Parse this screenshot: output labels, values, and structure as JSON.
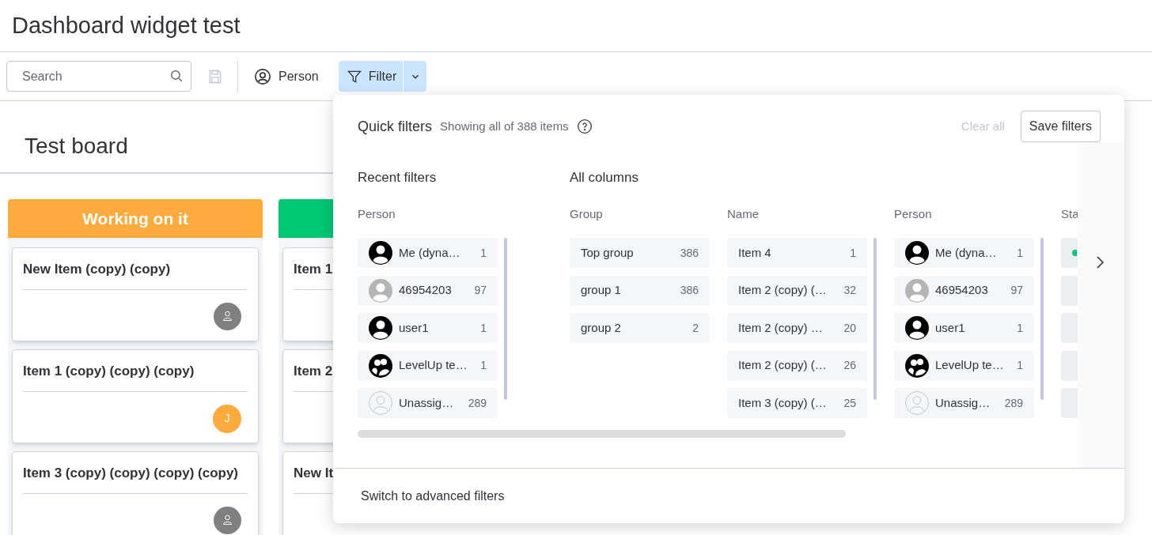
{
  "page": {
    "title": "Dashboard widget test"
  },
  "toolbar": {
    "search": {
      "placeholder": "Search"
    },
    "person_button": "Person",
    "filter_button": {
      "label": "Filter",
      "active": true
    }
  },
  "board": {
    "title": "Test board",
    "groups": [
      {
        "title": "Working on it",
        "color": "#fdab3d",
        "cards": [
          {
            "title": "New Item (copy) (copy)",
            "assignee": {
              "kind": "placeholder"
            }
          },
          {
            "title": "Item 1 (copy) (copy) (copy)",
            "assignee": {
              "kind": "initial",
              "initial": "J"
            }
          },
          {
            "title": "Item 3 (copy) (copy) (copy) (copy)",
            "assignee": {
              "kind": "placeholder"
            }
          }
        ]
      },
      {
        "color": "#00c875",
        "cards": [
          {
            "title": "Item 1"
          },
          {
            "title": "Item 2"
          },
          {
            "title": "New It"
          }
        ]
      }
    ]
  },
  "filter_panel": {
    "title": "Quick filters",
    "summary": "Showing all of 388 items",
    "clear_all": {
      "label": "Clear all",
      "disabled": true
    },
    "save_button": "Save filters",
    "recent": {
      "title": "Recent filters",
      "columns": [
        {
          "title": "Person",
          "options": [
            {
              "label": "Me (dyna…",
              "count": "1",
              "avatar": {
                "kind": "person"
              }
            },
            {
              "label": "46954203",
              "count": "97",
              "avatar": {
                "kind": "person_grey"
              }
            },
            {
              "label": "user1",
              "count": "1",
              "avatar": {
                "kind": "person"
              }
            },
            {
              "label": "LevelUp te…",
              "count": "1",
              "avatar": {
                "kind": "team"
              }
            },
            {
              "label": "Unassig…",
              "count": "289",
              "avatar": {
                "kind": "unassigned"
              }
            }
          ]
        }
      ]
    },
    "all_columns": {
      "title": "All columns",
      "columns": [
        {
          "title": "Group",
          "options": [
            {
              "label": "Top group",
              "count": "386"
            },
            {
              "label": "group 1",
              "count": "386"
            },
            {
              "label": "group 2",
              "count": "2"
            }
          ]
        },
        {
          "title": "Name",
          "options": [
            {
              "label": "Item 4",
              "count": "1"
            },
            {
              "label": "Item 2 (copy) (…",
              "count": "32"
            },
            {
              "label": "Item 2 (copy) …",
              "count": "20"
            },
            {
              "label": "Item 2 (copy) (…",
              "count": "26"
            },
            {
              "label": "Item 3 (copy) (…",
              "count": "25"
            }
          ]
        },
        {
          "title": "Person",
          "options": [
            {
              "label": "Me (dyna…",
              "count": "1",
              "avatar": {
                "kind": "person"
              }
            },
            {
              "label": "46954203",
              "count": "97",
              "avatar": {
                "kind": "person_grey"
              }
            },
            {
              "label": "user1",
              "count": "1",
              "avatar": {
                "kind": "person"
              }
            },
            {
              "label": "LevelUp te…",
              "count": "1",
              "avatar": {
                "kind": "team"
              }
            },
            {
              "label": "Unassig…",
              "count": "289",
              "avatar": {
                "kind": "unassigned"
              }
            }
          ]
        },
        {
          "title": "Sta",
          "options": [
            {
              "kind": "status",
              "color": "#00c875"
            },
            {
              "kind": "status"
            },
            {
              "kind": "status"
            },
            {
              "kind": "status"
            },
            {
              "kind": "status"
            }
          ]
        }
      ]
    },
    "footer_link": "Switch to advanced filters"
  }
}
